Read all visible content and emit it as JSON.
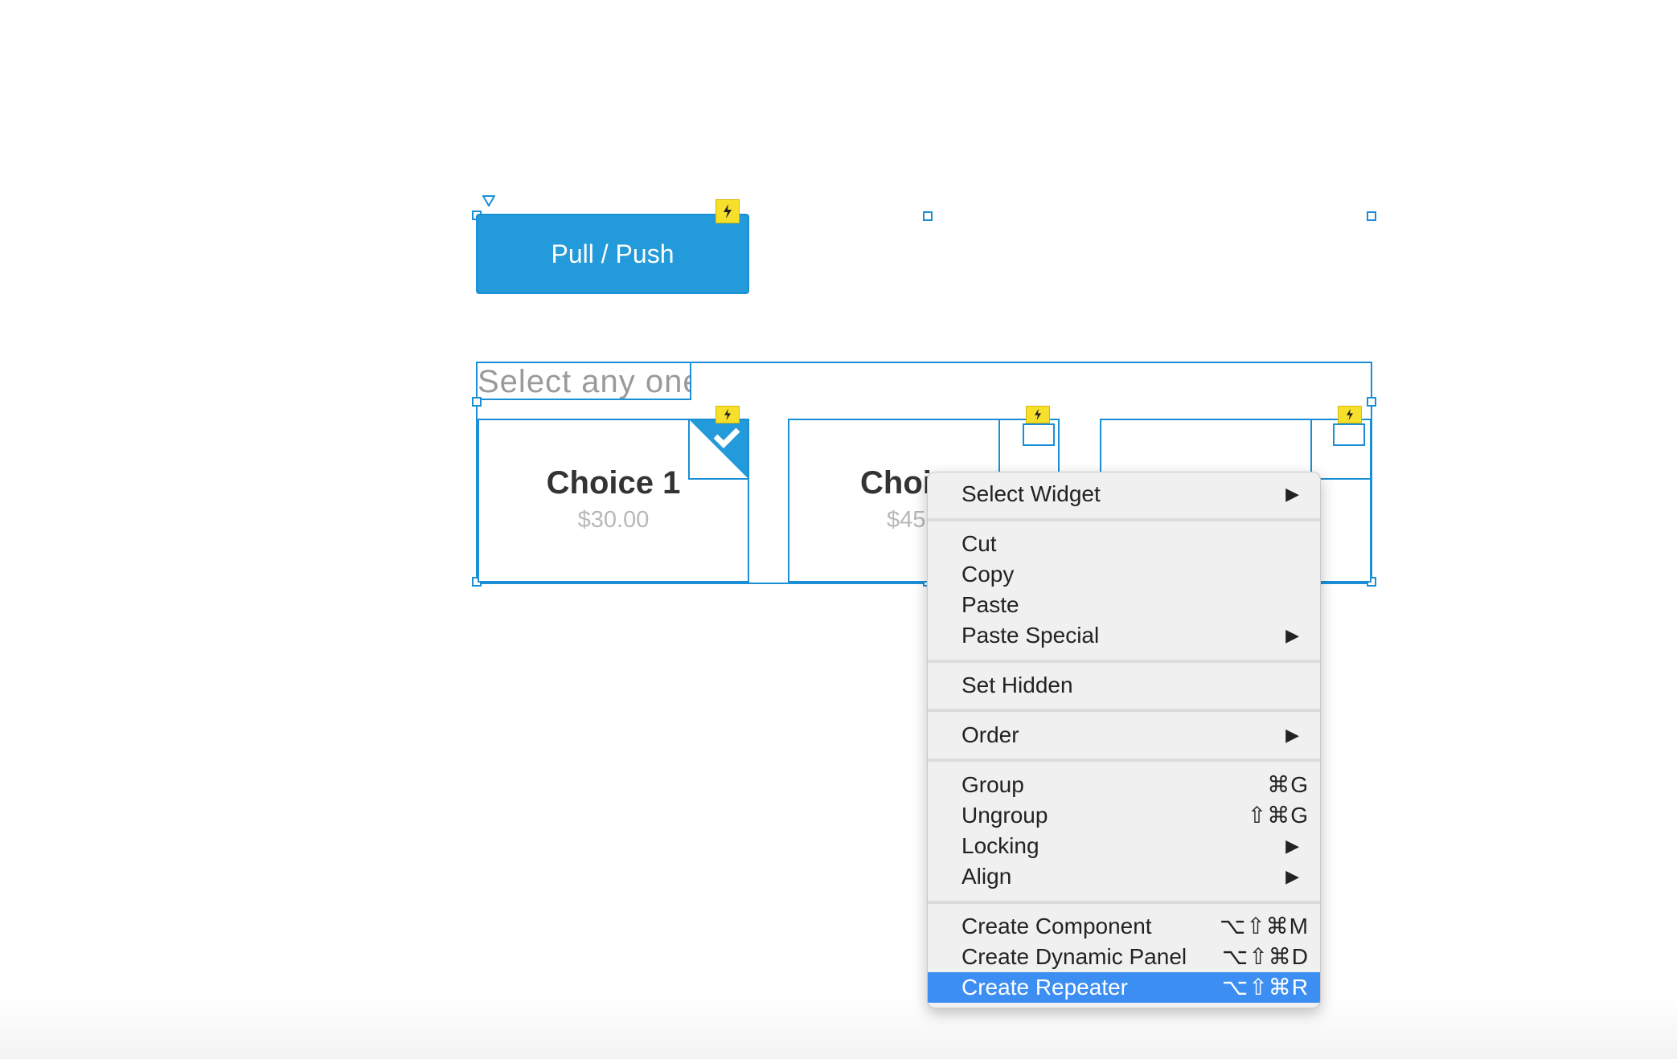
{
  "canvas": {
    "button": {
      "label": "Pull / Push"
    },
    "heading": {
      "text": "Select any one"
    },
    "cards": [
      {
        "title": "Choice 1",
        "price": "$30.00"
      },
      {
        "title": "Choi",
        "price": "$45"
      },
      {
        "title": "",
        "price": ""
      }
    ]
  },
  "context_menu": {
    "groups": [
      [
        {
          "label": "Select Widget",
          "submenu": true
        }
      ],
      [
        {
          "label": "Cut"
        },
        {
          "label": "Copy"
        },
        {
          "label": "Paste"
        },
        {
          "label": "Paste Special",
          "submenu": true
        }
      ],
      [
        {
          "label": "Set Hidden"
        }
      ],
      [
        {
          "label": "Order",
          "submenu": true
        }
      ],
      [
        {
          "label": "Group",
          "shortcut": "⌘G"
        },
        {
          "label": "Ungroup",
          "shortcut": "⇧⌘G"
        },
        {
          "label": "Locking",
          "submenu": true
        },
        {
          "label": "Align",
          "submenu": true
        }
      ],
      [
        {
          "label": "Create Component",
          "shortcut": "⌥⇧⌘M"
        },
        {
          "label": "Create Dynamic Panel",
          "shortcut": "⌥⇧⌘D"
        },
        {
          "label": "Create Repeater",
          "shortcut": "⌥⇧⌘R",
          "highlighted": true
        }
      ]
    ],
    "submenu_arrow": "▶",
    "highlight_color": "#3d8ef2"
  },
  "colors": {
    "selection": "#1a8fd6",
    "button_bg": "#239ad9",
    "interaction_badge": "#f7e02b"
  }
}
